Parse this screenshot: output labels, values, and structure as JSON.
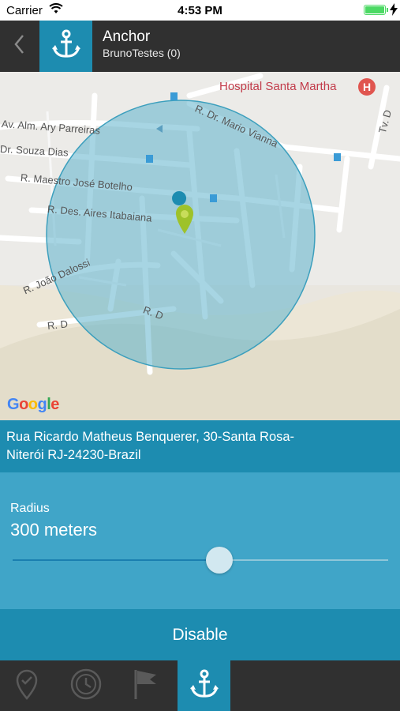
{
  "status_bar": {
    "carrier": "Carrier",
    "time": "4:53 PM",
    "battery_level": 1.0
  },
  "header": {
    "title": "Anchor",
    "subtitle": "BrunoTestes (0)",
    "back_icon": "chevron-left-icon",
    "anchor_icon": "anchor-icon",
    "accent_color": "#1d8cb0",
    "background_color": "#303030"
  },
  "map": {
    "hospital": "Hospital Santa Martha",
    "hospital_icon_letter": "H",
    "streets": [
      "Av. Alm. Ary Parreiras",
      "R. Dr. Mario Vianna",
      "Dr. Souza Dias",
      "R. Maestro José Botelho",
      "R. Des. Aires Itabaiana",
      "R. João Dalossi",
      "R. D",
      "R. D",
      "Tv. D"
    ],
    "google_logo": "Google",
    "circle_color": "#5fb3cc"
  },
  "address": {
    "line1": "Rua Ricardo Matheus Benquerer, 30-Santa Rosa-",
    "line2": "Niterói RJ-24230-Brazil"
  },
  "radius": {
    "label": "Radius",
    "value_text": "300 meters",
    "slider_fraction": 0.55
  },
  "actions": {
    "disable_label": "Disable"
  },
  "tabs": [
    {
      "icon": "location-check-icon",
      "active": false
    },
    {
      "icon": "history-clock-icon",
      "active": false
    },
    {
      "icon": "flag-icon",
      "active": false
    },
    {
      "icon": "anchor-icon",
      "active": true
    }
  ]
}
